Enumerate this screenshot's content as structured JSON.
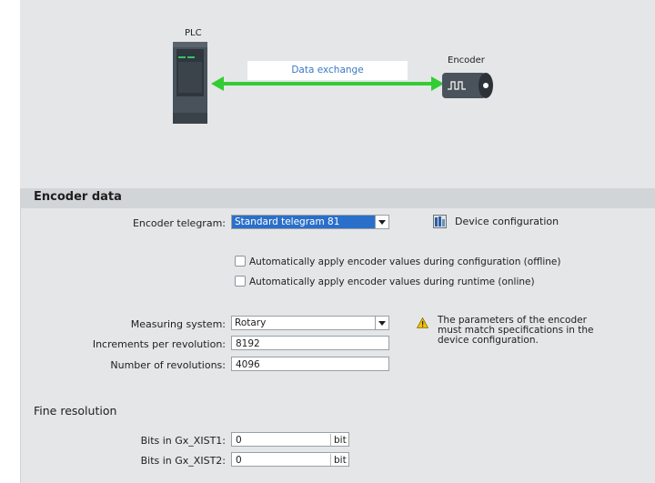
{
  "diagram": {
    "plc_label": "PLC",
    "encoder_label": "Encoder",
    "data_exchange_label": "Data exchange"
  },
  "encoder_data": {
    "section_title": "Encoder data",
    "telegram_label": "Encoder telegram:",
    "telegram_value": "Standard telegram 81",
    "device_config_label": "Device configuration",
    "auto_offline_label": "Automatically apply encoder values during configuration (offline)",
    "auto_online_label": "Automatically apply encoder values during runtime (online)",
    "measuring_system_label": "Measuring system:",
    "measuring_system_value": "Rotary",
    "increments_label": "Increments per revolution:",
    "increments_value": "8192",
    "revolutions_label": "Number of revolutions:",
    "revolutions_value": "4096",
    "note_text": "The parameters of the encoder must match specifications in the device configuration."
  },
  "fine_resolution": {
    "section_title": "Fine resolution",
    "xist1_label": "Bits in Gx_XIST1:",
    "xist1_value": "0",
    "xist1_unit": "bit",
    "xist2_label": "Bits in Gx_XIST2:",
    "xist2_value": "0",
    "xist2_unit": "bit"
  },
  "colors": {
    "accent_selection": "#2a6fc9",
    "arrow_green": "#33cc33",
    "data_exchange_text": "#3a78c4",
    "warning_yellow": "#f2c200"
  },
  "icons": {
    "plc": "plc-device-icon",
    "encoder": "encoder-device-icon",
    "device_config": "device-configuration-icon",
    "warning": "warning-icon"
  }
}
